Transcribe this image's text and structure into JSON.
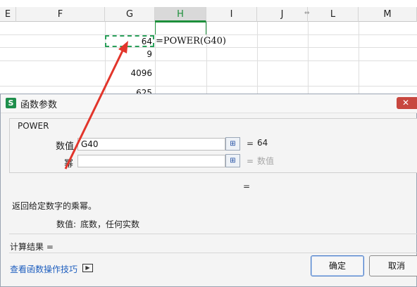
{
  "sheet": {
    "columns": [
      "E",
      "F",
      "G",
      "H",
      "I",
      "J",
      "L",
      "M"
    ],
    "selected_column": "H",
    "g_values": [
      "64",
      "9",
      "4096",
      "625"
    ],
    "formula": "=POWER(G40)"
  },
  "dialog": {
    "title": "函数参数",
    "function_name": "POWER",
    "args": [
      {
        "label": "数值",
        "value": "G40",
        "result": "64"
      },
      {
        "label": "幂",
        "value": "",
        "result": "数值"
      }
    ],
    "result_equals": "=",
    "description": "返回给定数字的乘幂。",
    "arg_desc_name": "数值:",
    "arg_desc_text": "底数，任何实数",
    "calc_result_label": "计算结果 =",
    "help_link": "查看函数操作技巧",
    "ok_label": "确定",
    "cancel_label": "取消"
  },
  "colors": {
    "accent_green": "#1d8f3b",
    "arrow_red": "#e2352b",
    "link_blue": "#1f5fbf"
  },
  "icons": [
    "spreadsheet-app-icon",
    "close-icon",
    "range-picker-icon",
    "video-help-icon",
    "column-resize-icon"
  ]
}
